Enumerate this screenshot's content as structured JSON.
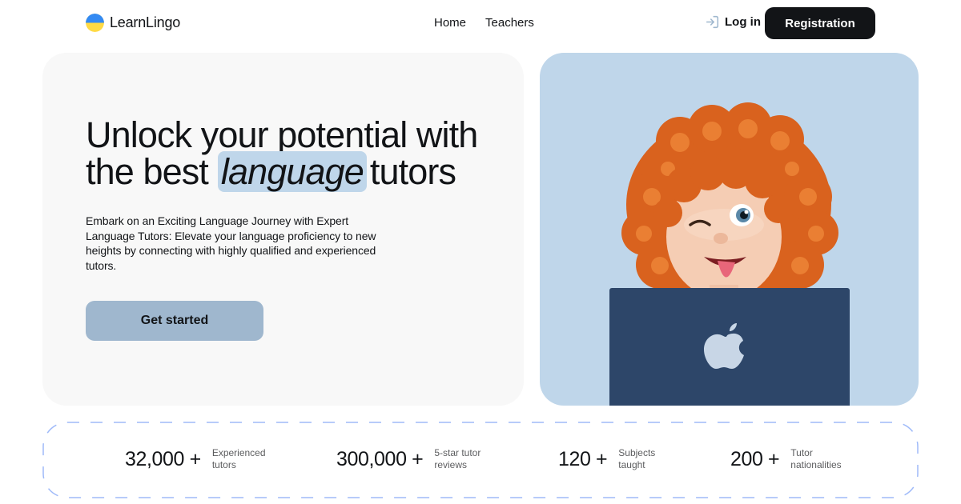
{
  "header": {
    "logo_text": "LearnLingo",
    "nav": [
      {
        "label": "Home"
      },
      {
        "label": "Teachers"
      }
    ],
    "login_label": "Log in",
    "register_label": "Registration"
  },
  "hero": {
    "title_line1": "Unlock your potential with",
    "title_pre": "the best",
    "title_highlight": "language",
    "title_post": "tutors",
    "description": "Embark on an Exciting Language Journey with Expert Language Tutors: Elevate your language proficiency to new heights by connecting with highly qualified and experienced tutors.",
    "cta_label": "Get started"
  },
  "stats": [
    {
      "value": "32,000 +",
      "label_line1": "Experienced",
      "label_line2": "tutors"
    },
    {
      "value": "300,000 +",
      "label_line1": "5-star tutor",
      "label_line2": "reviews"
    },
    {
      "value": "120 +",
      "label_line1": "Subjects",
      "label_line2": "taught"
    },
    {
      "value": "200 +",
      "label_line1": "Tutor",
      "label_line2": "nationalities"
    }
  ],
  "colors": {
    "text": "#121417",
    "accent_light": "#bfd6ea",
    "accent_button": "#9fb7ce",
    "card_bg": "#f8f8f8",
    "dash_border": "#9fbaf9"
  },
  "icons": {
    "logo": "ukraine-flag-icon",
    "login": "login-arrow-icon",
    "laptop_logo": "apple-logo-icon"
  }
}
